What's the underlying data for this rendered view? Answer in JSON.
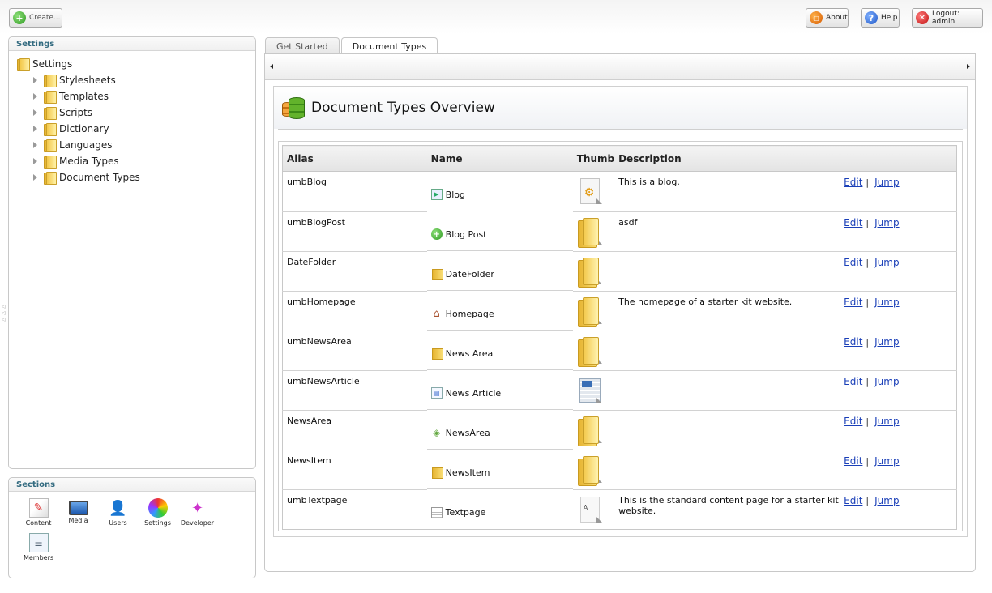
{
  "toolbar": {
    "create_label": "Create...",
    "about_label": "About",
    "help_label": "Help",
    "logout_label": "Logout: admin"
  },
  "settings_panel": {
    "title": "Settings",
    "root_label": "Settings",
    "items": [
      {
        "label": "Stylesheets"
      },
      {
        "label": "Templates"
      },
      {
        "label": "Scripts"
      },
      {
        "label": "Dictionary"
      },
      {
        "label": "Languages"
      },
      {
        "label": "Media Types"
      },
      {
        "label": "Document Types"
      }
    ]
  },
  "sections_panel": {
    "title": "Sections",
    "items": [
      {
        "label": "Content",
        "icon": "content-icon"
      },
      {
        "label": "Media",
        "icon": "media-icon"
      },
      {
        "label": "Users",
        "icon": "users-icon"
      },
      {
        "label": "Settings",
        "icon": "settings-icon"
      },
      {
        "label": "Developer",
        "icon": "developer-icon"
      },
      {
        "label": "Members",
        "icon": "members-icon"
      }
    ]
  },
  "tabs": [
    {
      "label": "Get Started",
      "active": false
    },
    {
      "label": "Document Types",
      "active": true
    }
  ],
  "overview": {
    "title": "Document Types Overview",
    "columns": {
      "alias": "Alias",
      "name": "Name",
      "thumb": "Thumb",
      "description": "Description"
    },
    "edit_label": "Edit",
    "jump_label": "Jump",
    "separator": "|",
    "rows": [
      {
        "alias": "umbBlog",
        "name": "Blog",
        "icon": "blog-icon",
        "thumb": "doc-thumb",
        "description": "This is a blog."
      },
      {
        "alias": "umbBlogPost",
        "name": "Blog Post",
        "icon": "plus-icon",
        "thumb": "folder-thumb",
        "description": "asdf"
      },
      {
        "alias": "DateFolder",
        "name": "DateFolder",
        "icon": "folder-icon",
        "thumb": "folder-thumb",
        "description": ""
      },
      {
        "alias": "umbHomepage",
        "name": "Homepage",
        "icon": "home-icon",
        "thumb": "folder-thumb",
        "description": "The homepage of a starter kit website."
      },
      {
        "alias": "umbNewsArea",
        "name": "News Area",
        "icon": "folder-icon",
        "thumb": "folder-thumb",
        "description": ""
      },
      {
        "alias": "umbNewsArticle",
        "name": "News Article",
        "icon": "article-icon",
        "thumb": "news-thumb",
        "description": ""
      },
      {
        "alias": "NewsArea",
        "name": "NewsArea",
        "icon": "newsarea-icon",
        "thumb": "folder-thumb",
        "description": ""
      },
      {
        "alias": "NewsItem",
        "name": "NewsItem",
        "icon": "folder-icon",
        "thumb": "folder-thumb",
        "description": ""
      },
      {
        "alias": "umbTextpage",
        "name": "Textpage",
        "icon": "textpage-icon",
        "thumb": "text-thumb",
        "description": "This is the standard content page for a starter kit website."
      }
    ]
  }
}
